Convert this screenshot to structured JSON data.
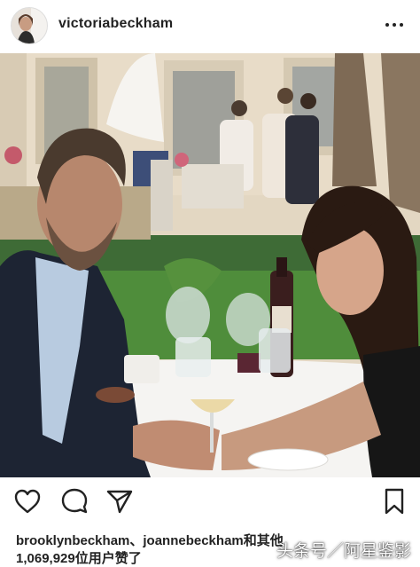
{
  "post": {
    "username": "victoriabeckham",
    "photo_alt": "photo"
  },
  "icons": {
    "more": "more-options-icon",
    "like": "heart-icon",
    "comment": "comment-icon",
    "share": "send-icon",
    "save": "bookmark-icon"
  },
  "likes": {
    "liked_by": "brooklynbeckham、joannebeckham和其他",
    "count": "1,069,929位用户赞了"
  },
  "watermark": {
    "text": "头条号／阿星鉴影"
  }
}
